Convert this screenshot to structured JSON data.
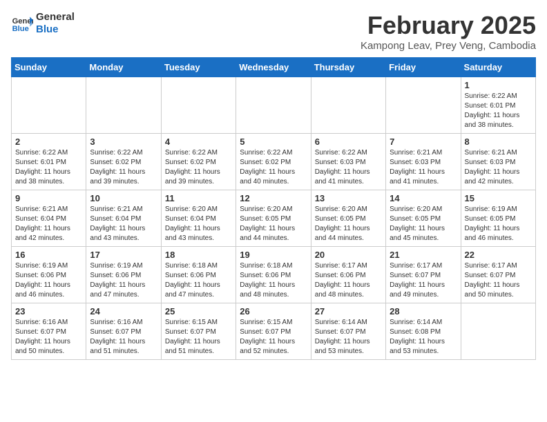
{
  "logo": {
    "line1": "General",
    "line2": "Blue"
  },
  "title": "February 2025",
  "subtitle": "Kampong Leav, Prey Veng, Cambodia",
  "weekdays": [
    "Sunday",
    "Monday",
    "Tuesday",
    "Wednesday",
    "Thursday",
    "Friday",
    "Saturday"
  ],
  "weeks": [
    [
      {
        "day": "",
        "info": ""
      },
      {
        "day": "",
        "info": ""
      },
      {
        "day": "",
        "info": ""
      },
      {
        "day": "",
        "info": ""
      },
      {
        "day": "",
        "info": ""
      },
      {
        "day": "",
        "info": ""
      },
      {
        "day": "1",
        "info": "Sunrise: 6:22 AM\nSunset: 6:01 PM\nDaylight: 11 hours\nand 38 minutes."
      }
    ],
    [
      {
        "day": "2",
        "info": "Sunrise: 6:22 AM\nSunset: 6:01 PM\nDaylight: 11 hours\nand 38 minutes."
      },
      {
        "day": "3",
        "info": "Sunrise: 6:22 AM\nSunset: 6:02 PM\nDaylight: 11 hours\nand 39 minutes."
      },
      {
        "day": "4",
        "info": "Sunrise: 6:22 AM\nSunset: 6:02 PM\nDaylight: 11 hours\nand 39 minutes."
      },
      {
        "day": "5",
        "info": "Sunrise: 6:22 AM\nSunset: 6:02 PM\nDaylight: 11 hours\nand 40 minutes."
      },
      {
        "day": "6",
        "info": "Sunrise: 6:22 AM\nSunset: 6:03 PM\nDaylight: 11 hours\nand 41 minutes."
      },
      {
        "day": "7",
        "info": "Sunrise: 6:21 AM\nSunset: 6:03 PM\nDaylight: 11 hours\nand 41 minutes."
      },
      {
        "day": "8",
        "info": "Sunrise: 6:21 AM\nSunset: 6:03 PM\nDaylight: 11 hours\nand 42 minutes."
      }
    ],
    [
      {
        "day": "9",
        "info": "Sunrise: 6:21 AM\nSunset: 6:04 PM\nDaylight: 11 hours\nand 42 minutes."
      },
      {
        "day": "10",
        "info": "Sunrise: 6:21 AM\nSunset: 6:04 PM\nDaylight: 11 hours\nand 43 minutes."
      },
      {
        "day": "11",
        "info": "Sunrise: 6:20 AM\nSunset: 6:04 PM\nDaylight: 11 hours\nand 43 minutes."
      },
      {
        "day": "12",
        "info": "Sunrise: 6:20 AM\nSunset: 6:05 PM\nDaylight: 11 hours\nand 44 minutes."
      },
      {
        "day": "13",
        "info": "Sunrise: 6:20 AM\nSunset: 6:05 PM\nDaylight: 11 hours\nand 44 minutes."
      },
      {
        "day": "14",
        "info": "Sunrise: 6:20 AM\nSunset: 6:05 PM\nDaylight: 11 hours\nand 45 minutes."
      },
      {
        "day": "15",
        "info": "Sunrise: 6:19 AM\nSunset: 6:05 PM\nDaylight: 11 hours\nand 46 minutes."
      }
    ],
    [
      {
        "day": "16",
        "info": "Sunrise: 6:19 AM\nSunset: 6:06 PM\nDaylight: 11 hours\nand 46 minutes."
      },
      {
        "day": "17",
        "info": "Sunrise: 6:19 AM\nSunset: 6:06 PM\nDaylight: 11 hours\nand 47 minutes."
      },
      {
        "day": "18",
        "info": "Sunrise: 6:18 AM\nSunset: 6:06 PM\nDaylight: 11 hours\nand 47 minutes."
      },
      {
        "day": "19",
        "info": "Sunrise: 6:18 AM\nSunset: 6:06 PM\nDaylight: 11 hours\nand 48 minutes."
      },
      {
        "day": "20",
        "info": "Sunrise: 6:17 AM\nSunset: 6:06 PM\nDaylight: 11 hours\nand 48 minutes."
      },
      {
        "day": "21",
        "info": "Sunrise: 6:17 AM\nSunset: 6:07 PM\nDaylight: 11 hours\nand 49 minutes."
      },
      {
        "day": "22",
        "info": "Sunrise: 6:17 AM\nSunset: 6:07 PM\nDaylight: 11 hours\nand 50 minutes."
      }
    ],
    [
      {
        "day": "23",
        "info": "Sunrise: 6:16 AM\nSunset: 6:07 PM\nDaylight: 11 hours\nand 50 minutes."
      },
      {
        "day": "24",
        "info": "Sunrise: 6:16 AM\nSunset: 6:07 PM\nDaylight: 11 hours\nand 51 minutes."
      },
      {
        "day": "25",
        "info": "Sunrise: 6:15 AM\nSunset: 6:07 PM\nDaylight: 11 hours\nand 51 minutes."
      },
      {
        "day": "26",
        "info": "Sunrise: 6:15 AM\nSunset: 6:07 PM\nDaylight: 11 hours\nand 52 minutes."
      },
      {
        "day": "27",
        "info": "Sunrise: 6:14 AM\nSunset: 6:07 PM\nDaylight: 11 hours\nand 53 minutes."
      },
      {
        "day": "28",
        "info": "Sunrise: 6:14 AM\nSunset: 6:08 PM\nDaylight: 11 hours\nand 53 minutes."
      },
      {
        "day": "",
        "info": ""
      }
    ]
  ]
}
